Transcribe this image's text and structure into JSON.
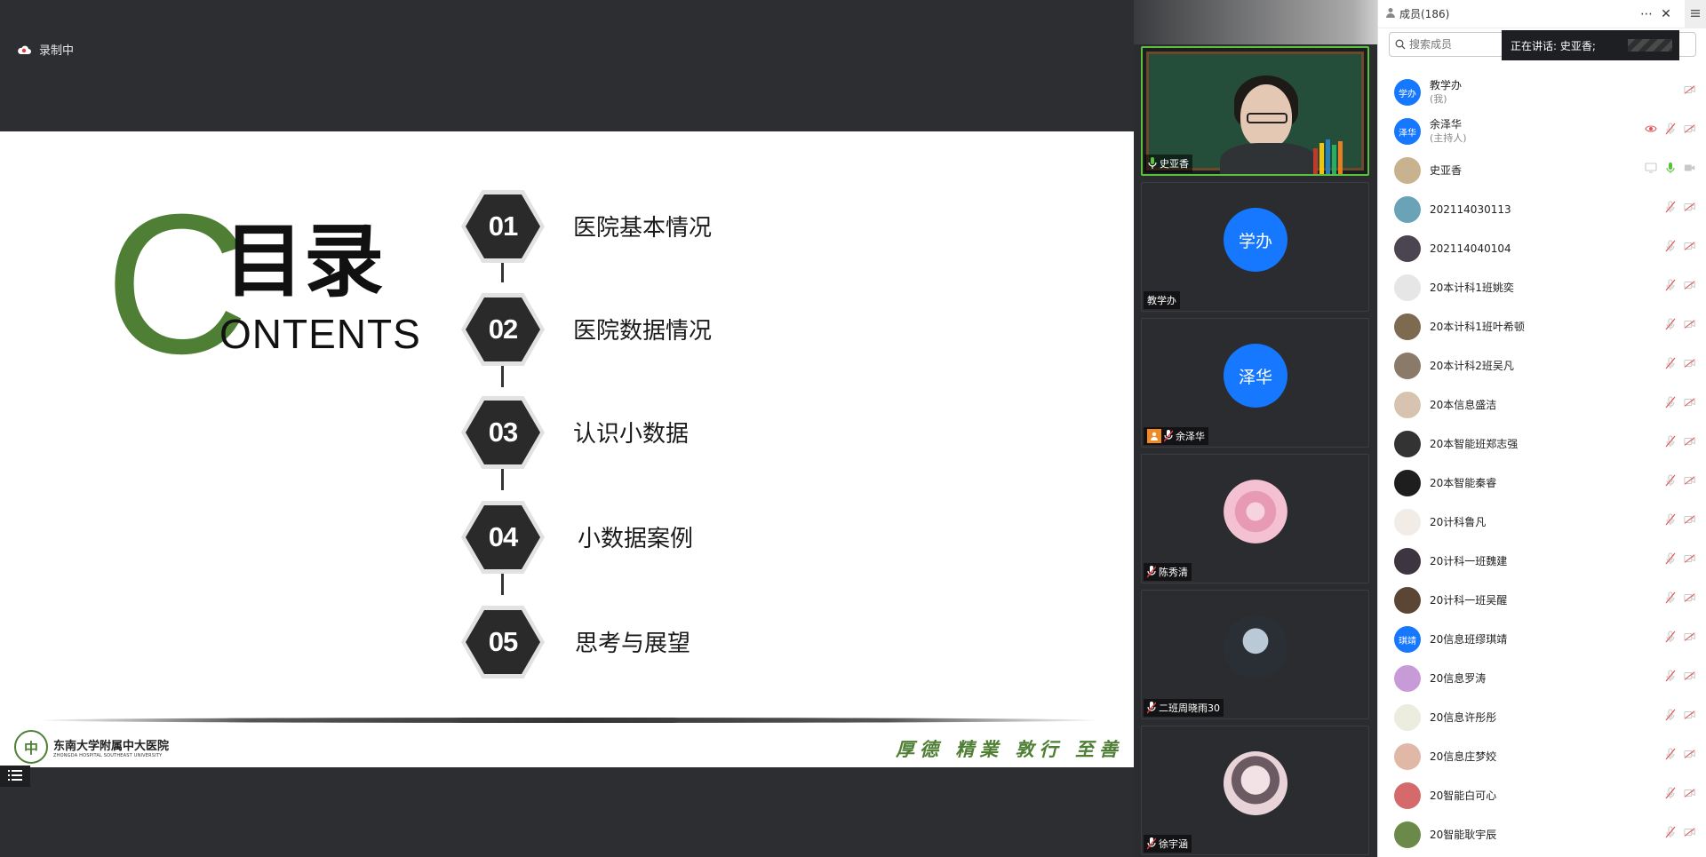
{
  "recording": {
    "label": "录制中"
  },
  "slide": {
    "big_letter": "C",
    "title_cn": "目录",
    "title_en": "ONTENTS",
    "toc": [
      {
        "num": "01",
        "text": "医院基本情况"
      },
      {
        "num": "02",
        "text": "医院数据情况"
      },
      {
        "num": "03",
        "text": "认识小数据"
      },
      {
        "num": "04",
        "text": "小数据案例"
      },
      {
        "num": "05",
        "text": "思考与展望"
      }
    ],
    "hospital_seal": "中",
    "hospital_cn": "东南大学附属中大医院",
    "hospital_en": "ZHONGDA HOSPITAL SOUTHEAST UNIVERSITY",
    "motto": "厚德 精業 敦行 至善"
  },
  "videos": [
    {
      "name": "史亚香",
      "type": "camera"
    },
    {
      "name": "教学办",
      "avatar_text": "学办",
      "type": "avatar"
    },
    {
      "name": "余泽华",
      "avatar_text": "泽华",
      "type": "avatar"
    },
    {
      "name": "陈秀清",
      "type": "photo"
    },
    {
      "name": "二班周晓雨30",
      "type": "photo"
    },
    {
      "name": "徐宇涵",
      "type": "photo"
    }
  ],
  "panel": {
    "title": "成员(186)",
    "search_placeholder": "搜索成员",
    "speaking_label": "正在讲话: 史亚香;",
    "members": [
      {
        "name": "教学办",
        "sub": "(我)",
        "avatar_text": "学办",
        "avatar_color": "#1677ff"
      },
      {
        "name": "余泽华",
        "sub": "(主持人)",
        "avatar_text": "泽华",
        "avatar_color": "#1677ff"
      },
      {
        "name": "史亚香",
        "sub": "",
        "avatar_text": "",
        "avatar_color": "#c9b28f"
      },
      {
        "name": "202114030113",
        "sub": "",
        "avatar_text": "",
        "avatar_color": "#6aa3b8"
      },
      {
        "name": "202114040104",
        "sub": "",
        "avatar_text": "",
        "avatar_color": "#4a4550"
      },
      {
        "name": "20本计科1班姚奕",
        "sub": "",
        "avatar_text": "",
        "avatar_color": "#e6e6e6"
      },
      {
        "name": "20本计科1班叶希顿",
        "sub": "",
        "avatar_text": "",
        "avatar_color": "#7d6a4f"
      },
      {
        "name": "20本计科2班吴凡",
        "sub": "",
        "avatar_text": "",
        "avatar_color": "#8a7a6a"
      },
      {
        "name": "20本信息盛洁",
        "sub": "",
        "avatar_text": "",
        "avatar_color": "#d8c3b0"
      },
      {
        "name": "20本智能班郑志强",
        "sub": "",
        "avatar_text": "",
        "avatar_color": "#333333"
      },
      {
        "name": "20本智能秦睿",
        "sub": "",
        "avatar_text": "",
        "avatar_color": "#1e1e1e"
      },
      {
        "name": "20计科鲁凡",
        "sub": "",
        "avatar_text": "",
        "avatar_color": "#f1ede6"
      },
      {
        "name": "20计科一班魏建",
        "sub": "",
        "avatar_text": "",
        "avatar_color": "#3d3540"
      },
      {
        "name": "20计科一班吴醒",
        "sub": "",
        "avatar_text": "",
        "avatar_color": "#5b4535"
      },
      {
        "name": "20信息班缪琪靖",
        "sub": "",
        "avatar_text": "琪靖",
        "avatar_color": "#1677ff"
      },
      {
        "name": "20信息罗涛",
        "sub": "",
        "avatar_text": "",
        "avatar_color": "#c89ad8"
      },
      {
        "name": "20信息许彤彤",
        "sub": "",
        "avatar_text": "",
        "avatar_color": "#ececdf"
      },
      {
        "name": "20信息庄梦姣",
        "sub": "",
        "avatar_text": "",
        "avatar_color": "#e0b8a5"
      },
      {
        "name": "20智能白可心",
        "sub": "",
        "avatar_text": "",
        "avatar_color": "#d66a6a"
      },
      {
        "name": "20智能耿宇辰",
        "sub": "",
        "avatar_text": "",
        "avatar_color": "#6b8a4a"
      }
    ]
  },
  "colors": {
    "accent_green": "#4e7f34",
    "avatar_blue": "#1677ff",
    "active_border": "#59c13a"
  }
}
